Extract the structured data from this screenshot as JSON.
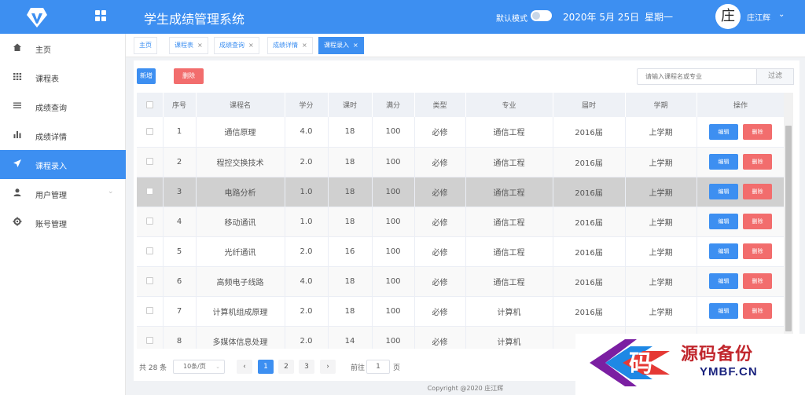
{
  "header": {
    "title": "学生成绩管理系统",
    "dark_mode_label": "默认模式",
    "date": "2020年 5月 25日",
    "weekday": "星期一",
    "avatar_char": "庄",
    "username": "庄江辉"
  },
  "sidebar": {
    "items": [
      {
        "label": "主页",
        "icon": "home-icon"
      },
      {
        "label": "课程表",
        "icon": "grid-icon"
      },
      {
        "label": "成绩查询",
        "icon": "list-icon"
      },
      {
        "label": "成绩详情",
        "icon": "bar-chart-icon"
      },
      {
        "label": "课程录入",
        "icon": "send-icon"
      },
      {
        "label": "用户管理",
        "icon": "user-icon"
      },
      {
        "label": "账号管理",
        "icon": "gear-icon"
      }
    ],
    "active_index": 4
  },
  "tabs": [
    {
      "label": "主页"
    },
    {
      "label": "课程表"
    },
    {
      "label": "成绩查询"
    },
    {
      "label": "成绩详情"
    },
    {
      "label": "课程录入"
    }
  ],
  "toolbar": {
    "add_label": "新增",
    "delete_label": "删除",
    "search_placeholder": "请输入课程名或专业",
    "search_button": "过滤"
  },
  "table": {
    "columns": [
      "序号",
      "课程名",
      "学分",
      "课时",
      "满分",
      "类型",
      "专业",
      "届时",
      "学期",
      "操作"
    ],
    "edit_label": "编辑",
    "delete_label": "删除",
    "rows": [
      {
        "no": "1",
        "name": "通信原理",
        "credit": "4.0",
        "hours": "18",
        "full": "100",
        "type": "必修",
        "major": "通信工程",
        "year": "2016届",
        "term": "上学期"
      },
      {
        "no": "2",
        "name": "程控交换技术",
        "credit": "2.0",
        "hours": "18",
        "full": "100",
        "type": "必修",
        "major": "通信工程",
        "year": "2016届",
        "term": "上学期"
      },
      {
        "no": "3",
        "name": "电路分析",
        "credit": "1.0",
        "hours": "18",
        "full": "100",
        "type": "必修",
        "major": "通信工程",
        "year": "2016届",
        "term": "上学期"
      },
      {
        "no": "4",
        "name": "移动通讯",
        "credit": "1.0",
        "hours": "18",
        "full": "100",
        "type": "必修",
        "major": "通信工程",
        "year": "2016届",
        "term": "上学期"
      },
      {
        "no": "5",
        "name": "光纤通讯",
        "credit": "2.0",
        "hours": "16",
        "full": "100",
        "type": "必修",
        "major": "通信工程",
        "year": "2016届",
        "term": "上学期"
      },
      {
        "no": "6",
        "name": "高频电子线路",
        "credit": "4.0",
        "hours": "18",
        "full": "100",
        "type": "必修",
        "major": "通信工程",
        "year": "2016届",
        "term": "上学期"
      },
      {
        "no": "7",
        "name": "计算机组成原理",
        "credit": "2.0",
        "hours": "18",
        "full": "100",
        "type": "必修",
        "major": "计算机",
        "year": "2016届",
        "term": "上学期"
      },
      {
        "no": "8",
        "name": "多媒体信息处理",
        "credit": "2.0",
        "hours": "14",
        "full": "100",
        "type": "必修",
        "major": "计算机",
        "year": "",
        "term": ""
      }
    ],
    "selected_index": 2
  },
  "pager": {
    "total": "共 28 条",
    "page_size": "10条/页",
    "pages": [
      "1",
      "2",
      "3"
    ],
    "current": "1",
    "goto_label": "前往",
    "goto_value": "1",
    "page_suffix": "页"
  },
  "footer": {
    "copyright": "Copyright @2020 庄江辉"
  },
  "watermark": {
    "char": "码",
    "cn": "源码备份",
    "en": "YMBF.CN"
  },
  "colors": {
    "primary": "#3d8ff1",
    "danger": "#f26d6d",
    "header_bg": "#3d8ff1",
    "selected_row": "#d0d0d0"
  }
}
